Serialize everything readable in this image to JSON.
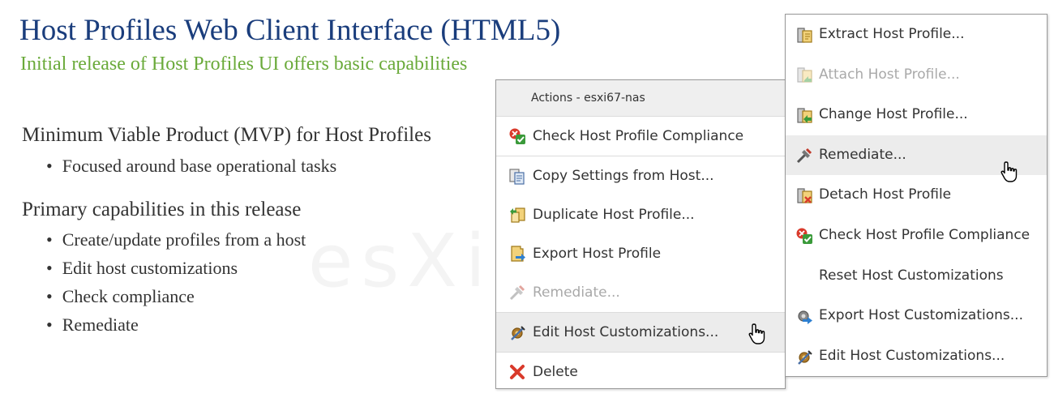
{
  "slide": {
    "title": "Host Profiles Web Client Interface (HTML5)",
    "subtitle": "Initial release of Host Profiles UI offers basic capabilities",
    "section1": {
      "heading": "Minimum Viable Product (MVP) for Host Profiles",
      "bullets": [
        "Focused around base operational tasks"
      ]
    },
    "section2": {
      "heading": "Primary capabilities in this release",
      "bullets": [
        "Create/update profiles from a host",
        "Edit host customizations",
        "Check compliance",
        "Remediate"
      ]
    }
  },
  "menu1": {
    "header": "Actions - esxi67-nas",
    "items": [
      {
        "label": "Check Host Profile Compliance",
        "icon": "check-compliance-icon"
      },
      {
        "label": "Copy Settings from Host...",
        "icon": "copy-settings-icon"
      },
      {
        "label": "Duplicate Host Profile...",
        "icon": "duplicate-profile-icon"
      },
      {
        "label": "Export Host Profile",
        "icon": "export-profile-icon"
      },
      {
        "label": "Remediate...",
        "icon": "remediate-icon",
        "disabled": true
      },
      {
        "label": "Edit Host Customizations...",
        "icon": "edit-customizations-icon",
        "hover": true
      },
      {
        "label": "Delete",
        "icon": "delete-icon"
      }
    ]
  },
  "menu2": {
    "items": [
      {
        "label": "Extract Host Profile...",
        "icon": "extract-profile-icon"
      },
      {
        "label": "Attach Host Profile...",
        "icon": "attach-profile-icon",
        "disabled": true
      },
      {
        "label": "Change Host Profile...",
        "icon": "change-profile-icon"
      },
      {
        "label": "Remediate...",
        "icon": "remediate-icon",
        "hover": true
      },
      {
        "label": "Detach Host Profile",
        "icon": "detach-profile-icon"
      },
      {
        "label": "Check Host Profile Compliance",
        "icon": "check-compliance-icon"
      },
      {
        "label": "Reset Host Customizations",
        "icon": ""
      },
      {
        "label": "Export Host Customizations...",
        "icon": "export-customizations-icon"
      },
      {
        "label": "Edit Host Customizations...",
        "icon": "edit-customizations-icon"
      }
    ]
  },
  "colors": {
    "title": "#1a3d7c",
    "subtitle": "#6aaa3a",
    "menu_hover": "#ececec",
    "disabled_text": "#a9a9a9",
    "delete_red": "#d93a2b"
  }
}
